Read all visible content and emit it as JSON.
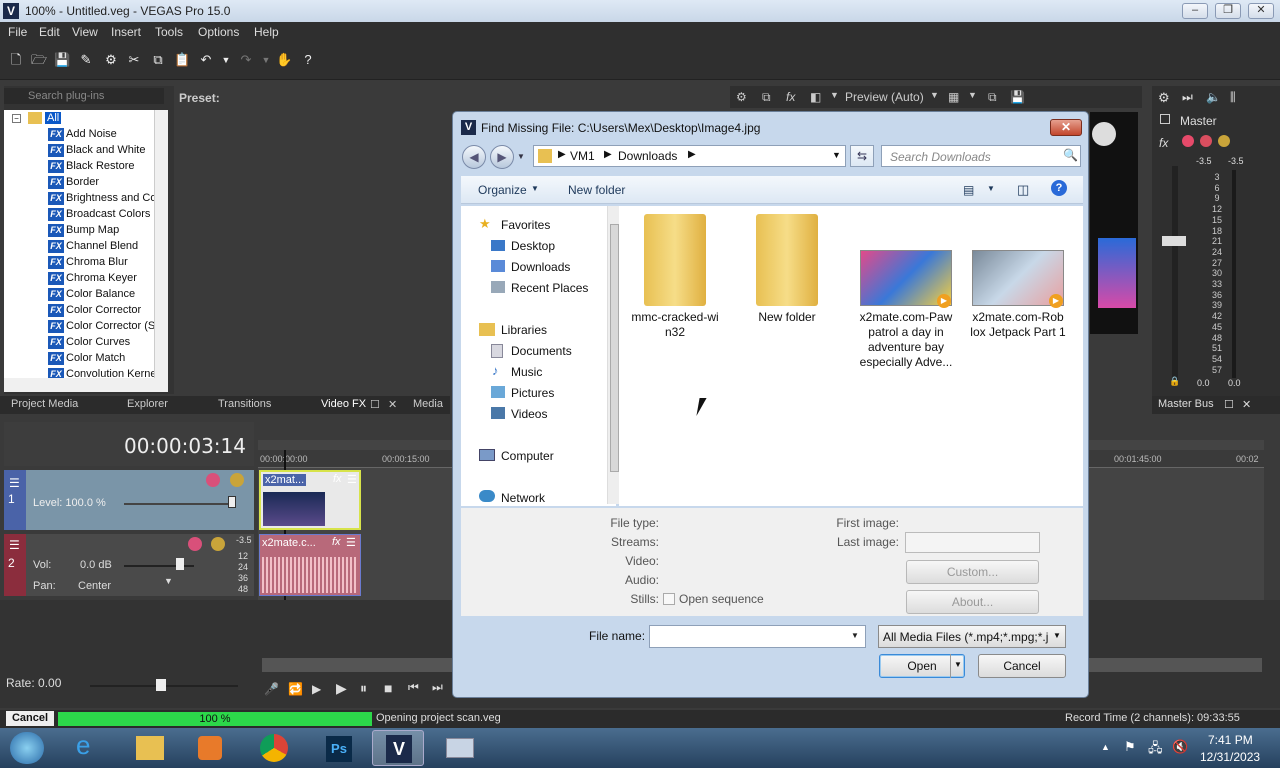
{
  "window": {
    "title": "100% - Untitled.veg - VEGAS Pro 15.0",
    "logo": "V"
  },
  "menu": [
    "File",
    "Edit",
    "View",
    "Insert",
    "Tools",
    "Options",
    "Help"
  ],
  "plugins": {
    "search_placeholder": "Search plug-ins",
    "preset_label": "Preset:",
    "root": "All",
    "fx_badge": "FX",
    "items": [
      "Add Noise",
      "Black and White",
      "Black Restore",
      "Border",
      "Brightness and Co",
      "Broadcast Colors",
      "Bump Map",
      "Channel Blend",
      "Chroma Blur",
      "Chroma Keyer",
      "Color Balance",
      "Color Corrector",
      "Color Corrector (S",
      "Color Curves",
      "Color Match",
      "Convolution Kerne"
    ]
  },
  "tabs": [
    "Project Media",
    "Explorer",
    "Transitions",
    "Video FX",
    "Media"
  ],
  "preview": {
    "mode": "Preview (Auto)"
  },
  "master": {
    "label": "Master",
    "bus_tab": "Master Bus",
    "db_left": "-3.5",
    "db_right": "-3.5",
    "scale": [
      "3",
      "6",
      "9",
      "12",
      "15",
      "18",
      "21",
      "24",
      "27",
      "30",
      "33",
      "36",
      "39",
      "42",
      "45",
      "48",
      "51",
      "54",
      "57"
    ],
    "out_left": "0.0",
    "out_right": "0.0"
  },
  "timeline": {
    "timecode": "00:00:03:14",
    "ruler": [
      "00:00:00:00",
      "00:00:15:00",
      "00:01:45:00",
      "00:02"
    ],
    "track1": {
      "num": "1",
      "level": "Level: 100.0 %",
      "clip": "x2mat..."
    },
    "track2": {
      "num": "2",
      "vol_label": "Vol:",
      "vol": "0.0 dB",
      "pan_label": "Pan:",
      "pan": "Center",
      "clip": "x2mate.c...",
      "db": "-3.5",
      "scale": [
        "12",
        "24",
        "36",
        "48"
      ]
    },
    "rate": "Rate: 0.00"
  },
  "status": {
    "cancel": "Cancel",
    "progress": "100 %",
    "progress_value": 100,
    "message": "Opening project scan.veg",
    "record_time": "Record Time (2 channels): 09:33:55"
  },
  "taskbar": {
    "time": "7:41 PM",
    "date": "12/31/2023"
  },
  "dialog": {
    "title": "Find Missing File: C:\\Users\\Mex\\Desktop\\Image4.jpg",
    "path": [
      "VM1",
      "Downloads"
    ],
    "search_placeholder": "Search Downloads",
    "organize": "Organize",
    "new_folder": "New folder",
    "nav": {
      "favorites": "Favorites",
      "fav_items": [
        "Desktop",
        "Downloads",
        "Recent Places"
      ],
      "libraries": "Libraries",
      "lib_items": [
        "Documents",
        "Music",
        "Pictures",
        "Videos"
      ],
      "computer": "Computer",
      "network": "Network"
    },
    "files": [
      {
        "name": "mmc-cracked-wi n32",
        "kind": "folder"
      },
      {
        "name": "New folder",
        "kind": "folder"
      },
      {
        "name": "x2mate.com-Paw patrol a day in adventure bay especially Adve...",
        "kind": "video"
      },
      {
        "name": "x2mate.com-Rob lox Jetpack Part 1",
        "kind": "video"
      }
    ],
    "details": {
      "file_type": "File type:",
      "streams": "Streams:",
      "video": "Video:",
      "audio": "Audio:",
      "stills": "Stills:",
      "open_sequence": "Open sequence",
      "first_image": "First image:",
      "last_image": "Last image:",
      "custom": "Custom...",
      "about": "About..."
    },
    "file_name_label": "File name:",
    "file_name_value": "",
    "filter": "All Media Files (*.mp4;*.mpg;*.j",
    "open": "Open",
    "cancel": "Cancel"
  }
}
